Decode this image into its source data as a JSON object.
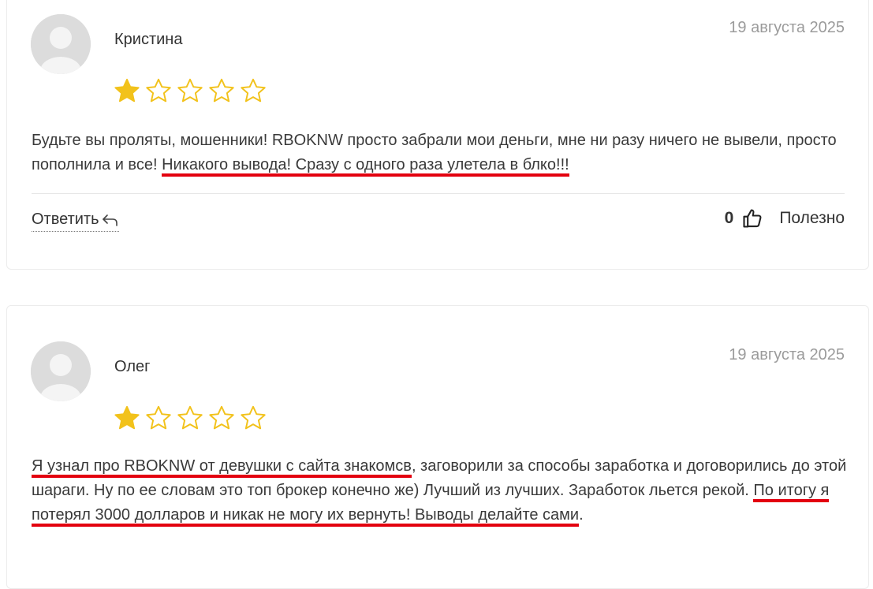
{
  "accent_color": "#e3000f",
  "star_color": "#f2c21b",
  "reviews": [
    {
      "author": "Кристина",
      "date": "19 августа 2025",
      "rating": 1,
      "max_rating": 5,
      "text_plain": "Будьте вы проляты, мошенники! RBOKNW просто забрали мои деньги, мне ни разу ничего не вывели, просто пополнила и все! ",
      "text_highlight": "Никакого вывода! Сразу с одного раза улетела в блко!!!",
      "reply_label": "Ответить",
      "useful_count": "0",
      "useful_label": "Полезно"
    },
    {
      "author": "Олег",
      "date": "19 августа 2025",
      "rating": 1,
      "max_rating": 5,
      "text_highlight_1": "Я узнал про RBOKNW от девушки с сайта знакомсв",
      "text_plain_1": ", заговорили за способы заработка и договорились до этой шараги. Ну по ее словам это топ брокер конечно же) Лучший из лучших. Заработок льется рекой. ",
      "text_highlight_2": "По итогу я потерял 3000 долларов и никак не могу их вернуть! Выводы делайте сами",
      "text_plain_2": "."
    }
  ]
}
